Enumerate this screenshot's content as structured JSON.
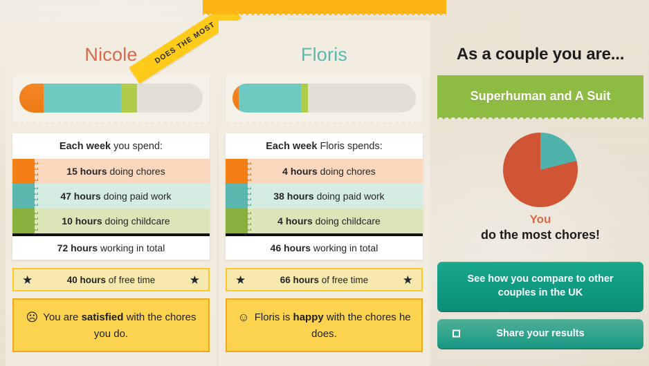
{
  "topbar": {
    "label": ""
  },
  "ribbon": {
    "label": "DOES THE MOST"
  },
  "people": [
    {
      "name": "Nicole",
      "accent": "#d8694a",
      "card_heading_bold": "Each week",
      "card_heading_rest": " you spend:",
      "rows": [
        {
          "value": "15 hours",
          "label": " doing chores",
          "color": "#f57f17"
        },
        {
          "value": "47 hours",
          "label": " doing paid work",
          "color": "#5cb8ae"
        },
        {
          "value": "10 hours",
          "label": " doing childcare",
          "color": "#87b03c"
        }
      ],
      "total_value": "72 hours",
      "total_label": " working in total",
      "free_time_value": "40 hours",
      "free_time_label": " of free time",
      "mood_face": "☹",
      "mood_pre": "You are ",
      "mood_bold": "satisfied",
      "mood_post": " with the chores you do.",
      "bar": {
        "chores": 15,
        "paid": 47,
        "childcare": 10,
        "scale_max": 112
      }
    },
    {
      "name": "Floris",
      "accent": "#57b8ae",
      "card_heading_bold": "Each week",
      "card_heading_rest": " Floris spends:",
      "rows": [
        {
          "value": "4 hours",
          "label": " doing chores",
          "color": "#f57f17"
        },
        {
          "value": "38 hours",
          "label": " doing paid work",
          "color": "#5cb8ae"
        },
        {
          "value": "4 hours",
          "label": " doing childcare",
          "color": "#87b03c"
        }
      ],
      "total_value": "46 hours",
      "total_label": " working in total",
      "free_time_value": "66 hours",
      "free_time_label": " of free time",
      "mood_face": "☺",
      "mood_pre": "Floris is ",
      "mood_bold": "happy",
      "mood_post": " with the chores he does.",
      "bar": {
        "chores": 4,
        "paid": 38,
        "childcare": 4,
        "scale_max": 112
      }
    }
  ],
  "summary": {
    "title": "As a couple you are...",
    "verdict": "Superhuman and A Suit",
    "winner": "You",
    "caption": "do the most chores!",
    "compare_button": "See how you compare to other couples in the UK",
    "share_button": "Share your results"
  },
  "chart_data": {
    "type": "pie",
    "title": "Share of chores",
    "labels": [
      "You",
      "Floris"
    ],
    "values": [
      15,
      4
    ],
    "percent": [
      78.9,
      21.1
    ],
    "colors": [
      "#cf5534",
      "#4fb3ab"
    ],
    "start_angle_deg": 0,
    "legend": "none",
    "annotations": [
      "You",
      "do the most chores!"
    ]
  },
  "icons": {
    "star": "★",
    "share": "share-box-icon"
  }
}
